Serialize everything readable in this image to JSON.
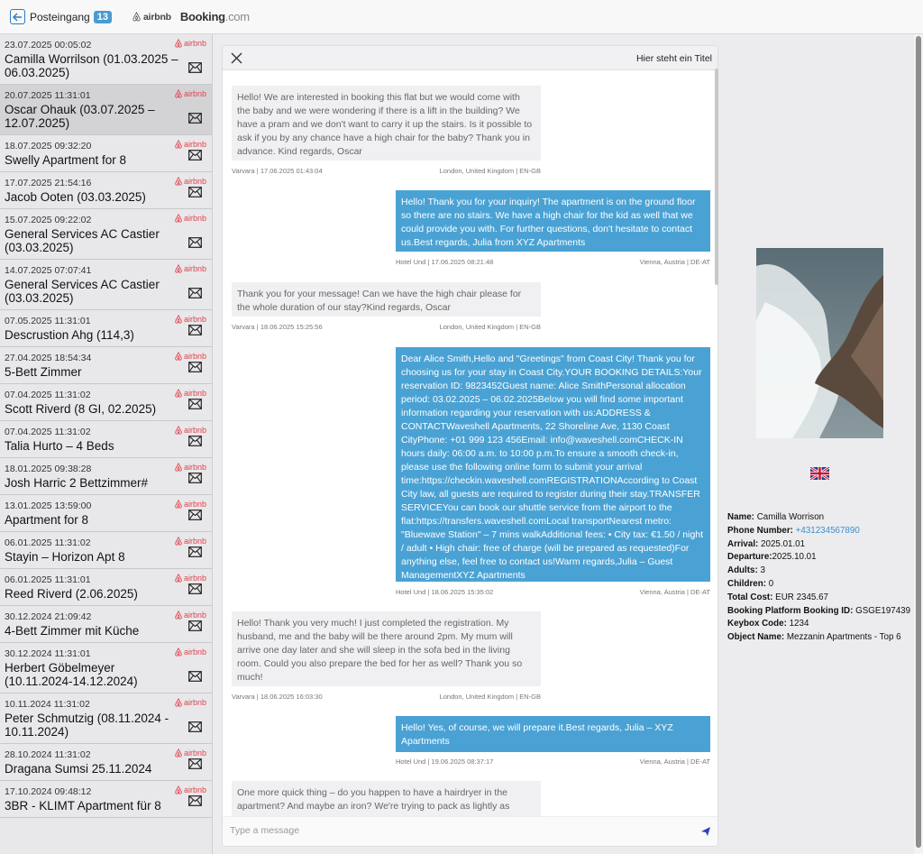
{
  "topbar": {
    "inbox_label": "Posteingang",
    "inbox_count": "13",
    "airbnb_label": "airbnb",
    "booking_label": "Booking",
    "booking_suffix": ".com"
  },
  "conversations": [
    {
      "timestamp": "23.07.2025 00:05:02",
      "name": "Camilla Worrilson (01.03.2025 – 06.03.2025)",
      "platform": "airbnb",
      "selected": false
    },
    {
      "timestamp": "20.07.2025 11:31:01",
      "name": "Oscar Ohauk (03.07.2025 – 12.07.2025)",
      "platform": "airbnb",
      "selected": true
    },
    {
      "timestamp": "18.07.2025 09:32:20",
      "name": "Swelly Apartment for 8",
      "platform": "airbnb",
      "selected": false
    },
    {
      "timestamp": "17.07.2025 21:54:16",
      "name": "Jacob Ooten (03.03.2025)",
      "platform": "airbnb",
      "selected": false
    },
    {
      "timestamp": "15.07.2025 09:22:02",
      "name": "General Services AC Castier (03.03.2025)",
      "platform": "airbnb",
      "selected": false
    },
    {
      "timestamp": "14.07.2025 07:07:41",
      "name": "General Services AC Castier (03.03.2025)",
      "platform": "airbnb",
      "selected": false
    },
    {
      "timestamp": "07.05.2025 11:31:01",
      "name": "Descrustion Ahg (114,3)",
      "platform": "airbnb",
      "selected": false
    },
    {
      "timestamp": "27.04.2025 18:54:34",
      "name": "5-Bett Zimmer",
      "platform": "airbnb",
      "selected": false
    },
    {
      "timestamp": "07.04.2025 11:31:02",
      "name": "Scott Riverd (8 GI, 02.2025)",
      "platform": "airbnb",
      "selected": false
    },
    {
      "timestamp": "07.04.2025 11:31:02",
      "name": "Talia Hurto – 4 Beds",
      "platform": "airbnb",
      "selected": false
    },
    {
      "timestamp": "18.01.2025 09:38:28",
      "name": "Josh Harric 2 Bettzimmer#",
      "platform": "airbnb",
      "selected": false
    },
    {
      "timestamp": "13.01.2025 13:59:00",
      "name": "Apartment for 8",
      "platform": "airbnb",
      "selected": false
    },
    {
      "timestamp": "06.01.2025 11:31:02",
      "name": "Stayin – Horizon Apt 8",
      "platform": "airbnb",
      "selected": false
    },
    {
      "timestamp": "06.01.2025 11:31:01",
      "name": "Reed Riverd (2.06.2025)",
      "platform": "airbnb",
      "selected": false
    },
    {
      "timestamp": "30.12.2024 21:09:42",
      "name": "4-Bett Zimmer mit Küche",
      "platform": "airbnb",
      "selected": false
    },
    {
      "timestamp": "30.12.2024 11:31:01",
      "name": "Herbert Göbelmeyer (10.11.2024-14.12.2024)",
      "platform": "airbnb",
      "selected": false
    },
    {
      "timestamp": "10.11.2024 11:31:02",
      "name": "Peter Schmutzig (08.11.2024 - 10.11.2024)",
      "platform": "airbnb",
      "selected": false
    },
    {
      "timestamp": "28.10.2024 11:31:02",
      "name": "Dragana Sumsi 25.11.2024",
      "platform": "airbnb",
      "selected": false
    },
    {
      "timestamp": "17.10.2024 09:48:12",
      "name": "3BR - KLIMT Apartment für 8",
      "platform": "airbnb",
      "selected": false
    }
  ],
  "chat": {
    "title": "Hier steht ein Titel",
    "composer_placeholder": "Type a message",
    "messages": [
      {
        "direction": "in",
        "text": "Hello! We are interested in booking this flat but we would come with the baby and we were wondering if there is a lift in the building? We have a pram and we don't want to carry it up the stairs. Is it possible to ask if you by any chance have a high chair for the baby? Thank you in advance. Kind regards, Oscar",
        "sender": "Varvara | 17.06.2025 01:43:04",
        "location": "London, United Kingdom | EN-GB"
      },
      {
        "direction": "out",
        "text": "Hello! Thank you for your inquiry! The apartment is on the ground floor so there are no stairs. We have a high chair for the kid as well that we could provide you with. For further questions, don't hesitate to contact us.Best regards, Julia from XYZ Apartments",
        "sender": "Hotel Und | 17.06.2025 08:21:48",
        "location": "Vienna, Austria | DE-AT"
      },
      {
        "direction": "in",
        "text": "Thank you for your message! Can we have the high chair please for the whole duration of our stay?Kind regards, Oscar",
        "sender": "Varvara | 18.06.2025 15:25:56",
        "location": "London, United Kingdom | EN-GB"
      },
      {
        "direction": "out",
        "text": "Dear Alice Smith,Hello and \"Greetings\" from Coast City! Thank you for choosing us for your stay in Coast City.YOUR BOOKING DETAILS:Your reservation ID: 9823452Guest name: Alice SmithPersonal allocation period: 03.02.2025 – 06.02.2025Below you will find some important information regarding your reservation with us:ADDRESS & CONTACTWaveshell Apartments, 22 Shoreline Ave, 1130 Coast CityPhone: +01 999 123 456Email: info@waveshell.comCHECK-IN hours daily: 06:00 a.m. to 10:00 p.m.To ensure a smooth check-in, please use the following online form to submit your arrival time:https://checkin.waveshell.comREGISTRATIONAccording to Coast City law, all guests are required to register during their stay.TRANSFER SERVICEYou can book our shuttle service from the airport to the flat:https://transfers.waveshell.comLocal transportNearest metro: \"Bluewave Station\" – 7 mins walkAdditional fees: • City tax: €1.50 / night / adult • High chair: free of charge (will be prepared as requested)For anything else, feel free to contact us!Warm regards,Julia – Guest ManagementXYZ Apartments",
        "sender": "Hotel Und | 18.06.2025 15:35:02",
        "location": "Vienna, Austria | DE-AT"
      },
      {
        "direction": "in",
        "text": "Hello! Thank you very much! I just completed the registration. My husband, me and the baby will be there around 2pm. My mum will arrive one day later and she will sleep in the sofa bed in the living room. Could you also prepare the bed for her as well? Thank you so much!",
        "sender": "Varvara | 18.06.2025 16:03:30",
        "location": "London, United Kingdom | EN-GB"
      },
      {
        "direction": "out",
        "text": "Hello! Yes, of course, we will prepare it.Best regards, Julia – XYZ Apartments",
        "sender": "Hotel Und | 19.06.2025 08:37:17",
        "location": "Vienna, Austria | DE-AT"
      },
      {
        "direction": "in",
        "text": "One more quick thing – do you happen to have a hairdryer in the apartment? And maybe an iron? We're trying to pack as lightly as",
        "sender": "",
        "location": ""
      }
    ]
  },
  "guest": {
    "name_label": "Name:",
    "name": "Camilla Worrison",
    "phone_label": "Phone Number:",
    "phone": "+431234567890",
    "arrival_label": "Arrival:",
    "arrival": "2025.01.01",
    "departure_label": "Departure:",
    "departure": "2025.10.01",
    "adults_label": "Adults:",
    "adults": "3",
    "children_label": "Children:",
    "children": "0",
    "total_label": "Total Cost:",
    "total": "EUR 2345.67",
    "booking_id_label": "Booking Platform Booking ID:",
    "booking_id": "GSGE197439",
    "keybox_label": "Keybox Code:",
    "keybox": "1234",
    "object_label": "Object Name:",
    "object": "Mezzanin Apartments - Top 6"
  },
  "colors": {
    "accent": "#4aa2d4",
    "airbnb": "#e2434f",
    "selected_row": "#d3d3d6"
  },
  "icons": [
    "back-arrow-icon",
    "airbnb-logo-icon",
    "envelope-icon",
    "close-icon",
    "send-icon",
    "uk-flag-icon"
  ]
}
